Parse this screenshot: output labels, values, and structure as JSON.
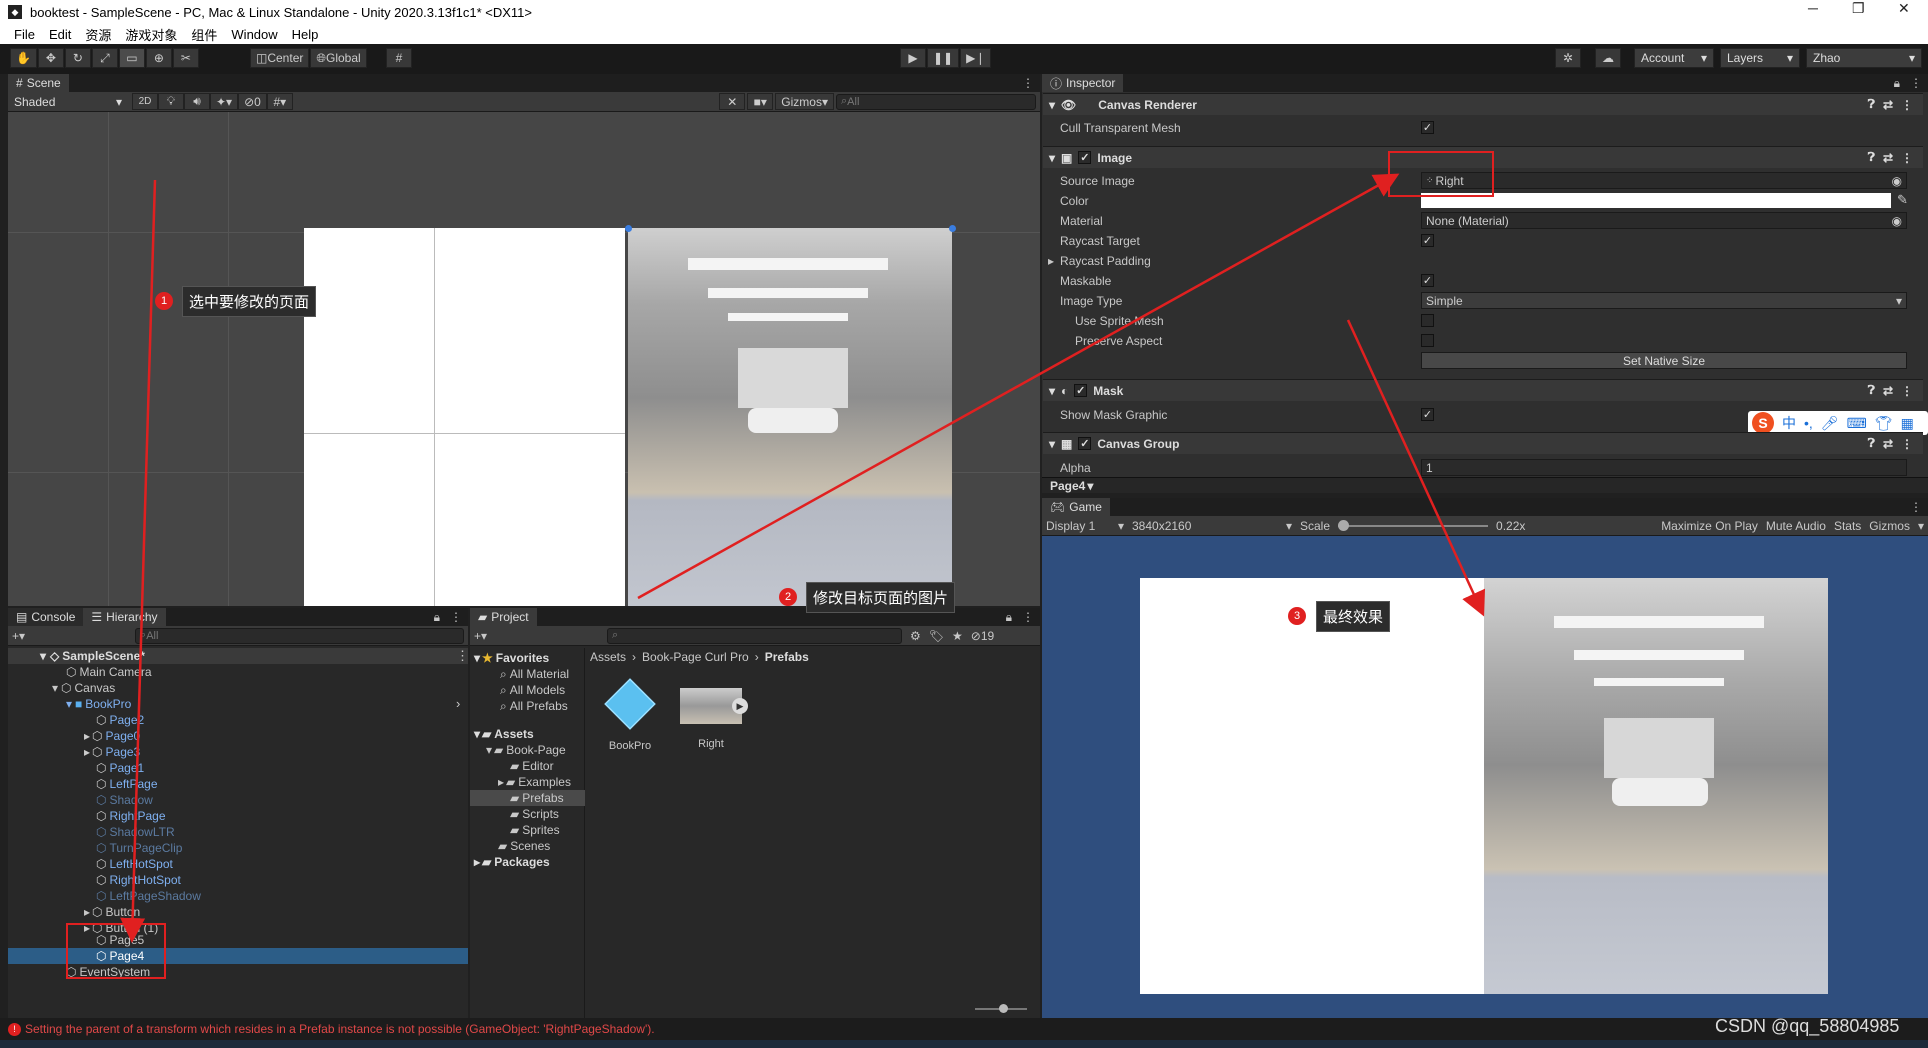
{
  "window": {
    "title": "booktest - SampleScene - PC, Mac & Linux Standalone - Unity 2020.3.13f1c1* <DX11>"
  },
  "menu": [
    "File",
    "Edit",
    "资源",
    "游戏对象",
    "组件",
    "Window",
    "Help"
  ],
  "toolbar": {
    "center_label": "Center",
    "global_label": "Global",
    "account_label": "Account",
    "layers_label": "Layers",
    "user_label": "Zhao"
  },
  "scene": {
    "tab": "Scene",
    "shading": "Shaded",
    "mode_2d": "2D",
    "hidden_count": "0",
    "gizmos": "Gizmos",
    "search_placeholder": "All",
    "callout1": "选中要修改的页面",
    "callout2": "修改目标页面的图片",
    "num1": "1",
    "num2": "2",
    "num3": "3"
  },
  "hierarchy": {
    "console_tab": "Console",
    "hierarchy_tab": "Hierarchy",
    "search_placeholder": "All",
    "items": [
      {
        "label": "SampleScene*"
      },
      {
        "label": "Main Camera"
      },
      {
        "label": "Canvas"
      },
      {
        "label": "BookPro"
      },
      {
        "label": "Page2"
      },
      {
        "label": "Page0"
      },
      {
        "label": "Page3"
      },
      {
        "label": "Page1"
      },
      {
        "label": "LeftPage"
      },
      {
        "label": "Shadow"
      },
      {
        "label": "RightPage"
      },
      {
        "label": "ShadowLTR"
      },
      {
        "label": "TurnPageClip"
      },
      {
        "label": "LeftHotSpot"
      },
      {
        "label": "RightHotSpot"
      },
      {
        "label": "LeftPageShadow"
      },
      {
        "label": "Button"
      },
      {
        "label": "Button (1)"
      },
      {
        "label": "Page5"
      },
      {
        "label": "Page4"
      },
      {
        "label": "EventSystem"
      }
    ]
  },
  "project": {
    "tab": "Project",
    "hidden_count": "19",
    "favorites_label": "Favorites",
    "favorites": [
      "All Material",
      "All Models",
      "All Prefabs"
    ],
    "assets_label": "Assets",
    "tree": [
      "Book-Page",
      "Editor",
      "Examples",
      "Prefabs",
      "Scripts",
      "Sprites",
      "Scenes"
    ],
    "packages_label": "Packages",
    "breadcrumb": [
      "Assets",
      "Book-Page Curl Pro",
      "Prefabs"
    ],
    "files": [
      {
        "name": "BookPro"
      },
      {
        "name": "Right"
      }
    ]
  },
  "inspector": {
    "tab": "Inspector",
    "canvas_renderer": "Canvas Renderer",
    "cull_label": "Cull Transparent Mesh",
    "image_header": "Image",
    "source_image_label": "Source Image",
    "source_image_value": "Right",
    "color_label": "Color",
    "material_label": "Material",
    "material_value": "None (Material)",
    "raycast_target_label": "Raycast Target",
    "raycast_padding_label": "Raycast Padding",
    "maskable_label": "Maskable",
    "image_type_label": "Image Type",
    "image_type_value": "Simple",
    "use_sprite_mesh_label": "Use Sprite Mesh",
    "preserve_aspect_label": "Preserve Aspect",
    "set_native_size": "Set Native Size",
    "mask_header": "Mask",
    "show_mask_label": "Show Mask Graphic",
    "canvas_group_header": "Canvas Group",
    "alpha_label": "Alpha",
    "alpha_value": "1",
    "footer_object": "Page4"
  },
  "ime": {
    "chinese_char": "中"
  },
  "game": {
    "tab": "Game",
    "display": "Display 1",
    "resolution": "3840x2160",
    "scale_label": "Scale",
    "scale_value": "0.22x",
    "maximize": "Maximize On Play",
    "mute": "Mute Audio",
    "stats": "Stats",
    "gizmos": "Gizmos",
    "callout3": "最终效果"
  },
  "status": {
    "error": "Setting the parent of a transform which resides in a Prefab instance is not possible (GameObject: 'RightPageShadow')."
  },
  "watermark": "CSDN @qq_58804985",
  "colors": {
    "accent_red": "#e02020",
    "selection_blue": "#2c5d87",
    "game_bg": "#2f4e7e"
  }
}
